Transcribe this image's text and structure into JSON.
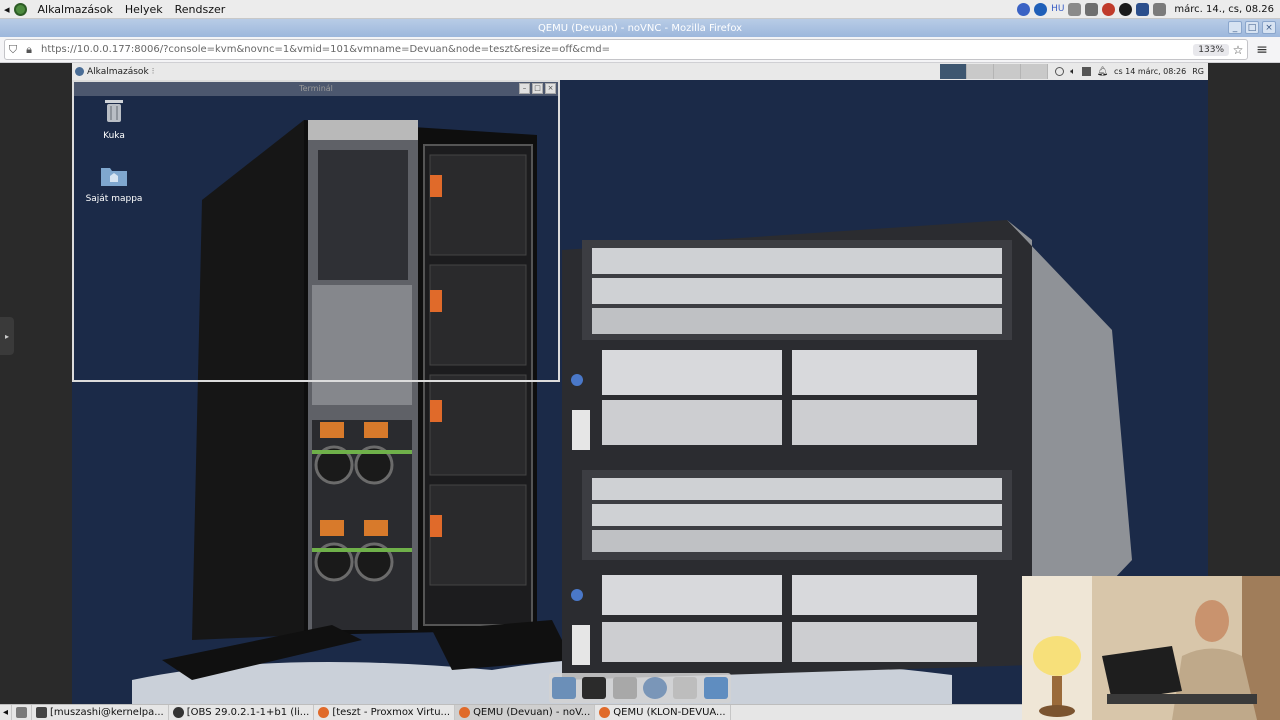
{
  "host_panel": {
    "menus": [
      "Alkalmazások",
      "Helyek",
      "Rendszer"
    ],
    "keyboard_layout": "HU",
    "clock": "márc. 14., cs, 08.26"
  },
  "browser": {
    "window_title": "QEMU (Devuan) - noVNC - Mozilla Firefox",
    "url": "https://10.0.0.177:8006/?console=kvm&novnc=1&vmid=101&vmname=Devuan&node=teszt&resize=off&cmd=",
    "zoom": "133%"
  },
  "guest": {
    "panel_menu": "Alkalmazások",
    "clock": "cs 14 márc, 08:26",
    "user_initials": "RG",
    "terminal_title": "Terminál",
    "desktop_icons": [
      {
        "label": "Kuka",
        "icon": "trash-icon"
      },
      {
        "label": "Saját mappa",
        "icon": "home-folder-icon"
      }
    ]
  },
  "taskbar": {
    "tasks": [
      {
        "label": "[muszashi@kernelpa...",
        "icon": "terminal-icon",
        "active": false
      },
      {
        "label": "[OBS 29.0.2.1-1+b1 (li...",
        "icon": "obs-icon",
        "active": false
      },
      {
        "label": "[teszt - Proxmox Virtu...",
        "icon": "firefox-icon",
        "active": false
      },
      {
        "label": "QEMU (Devuan) - noV...",
        "icon": "firefox-icon",
        "active": true
      },
      {
        "label": "QEMU (KLON-DEVUA...",
        "icon": "firefox-icon",
        "active": false
      }
    ]
  },
  "colors": {
    "guest_background": "#1b2a48",
    "workspace_active": "#3d5670",
    "firefox_titlebar": "#9db7dc"
  }
}
